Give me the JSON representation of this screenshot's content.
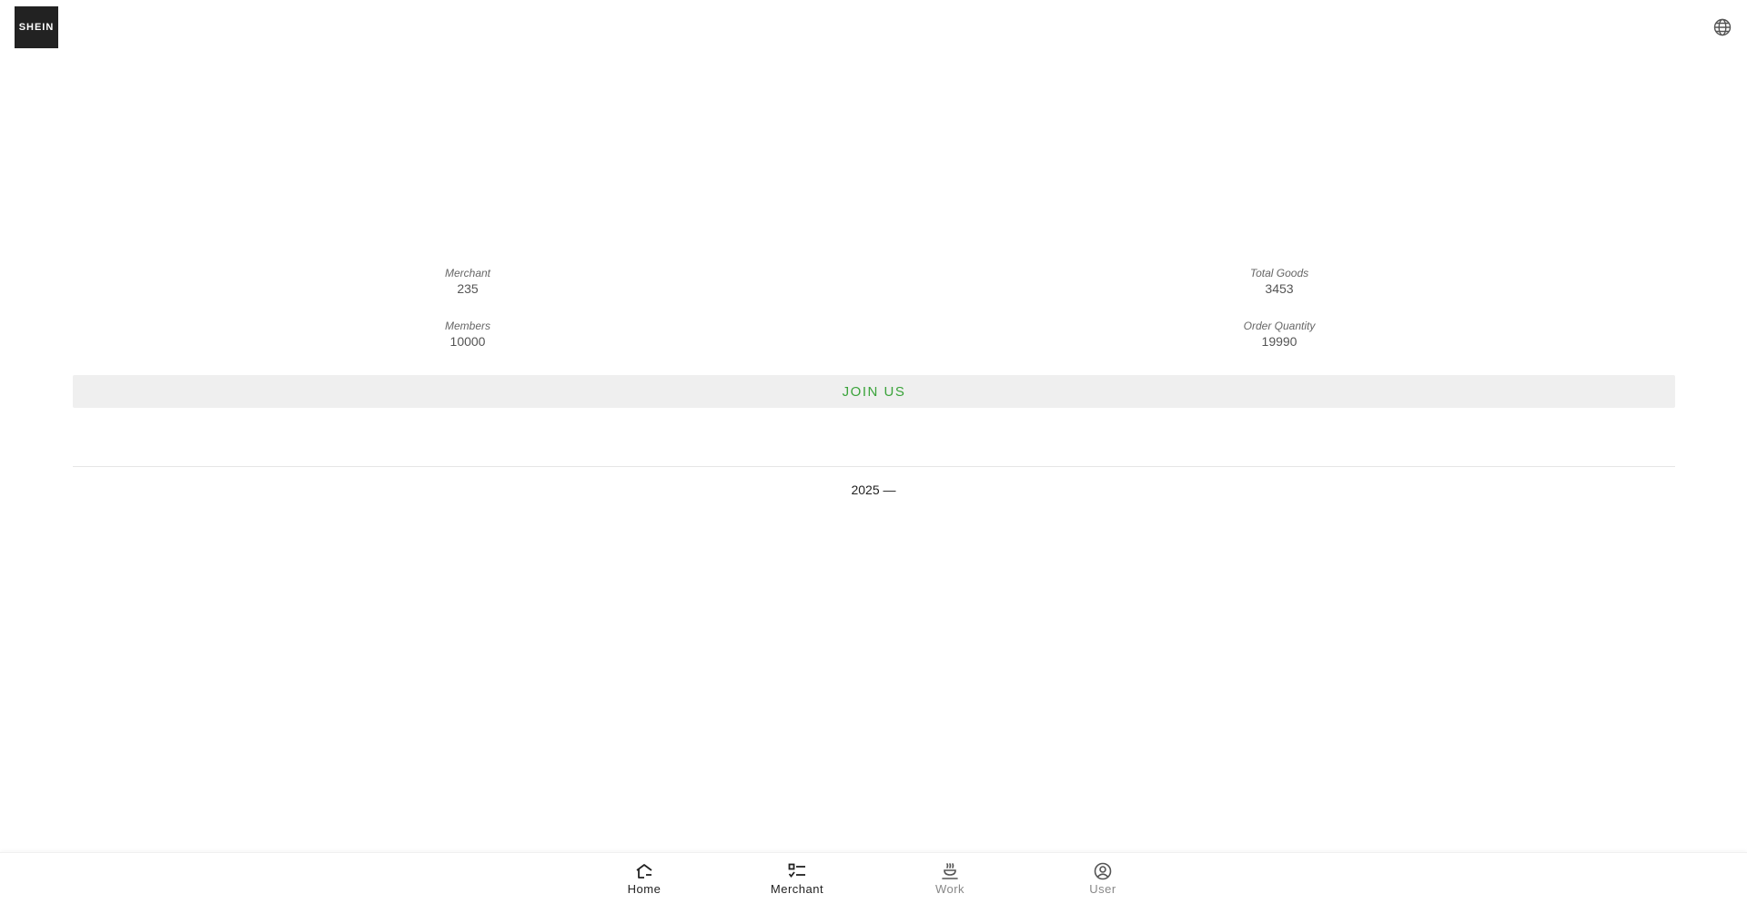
{
  "header": {
    "logo_text": "SHEIN",
    "language_icon": "globe-icon"
  },
  "stats": [
    {
      "label": "Merchant",
      "value": "235"
    },
    {
      "label": "Total Goods",
      "value": "3453"
    },
    {
      "label": "Members",
      "value": "10000"
    },
    {
      "label": "Order Quantity",
      "value": "19990"
    }
  ],
  "join_button": {
    "label": "JOIN US",
    "color": "#3aa33a"
  },
  "footer": {
    "year_text": "2025 —"
  },
  "bottom_nav": {
    "items": [
      {
        "label": "Home",
        "icon": "home-icon",
        "active": true
      },
      {
        "label": "Merchant",
        "icon": "list-icon",
        "active": true
      },
      {
        "label": "Work",
        "icon": "work-icon",
        "active": false
      },
      {
        "label": "User",
        "icon": "user-icon",
        "active": false
      }
    ]
  }
}
